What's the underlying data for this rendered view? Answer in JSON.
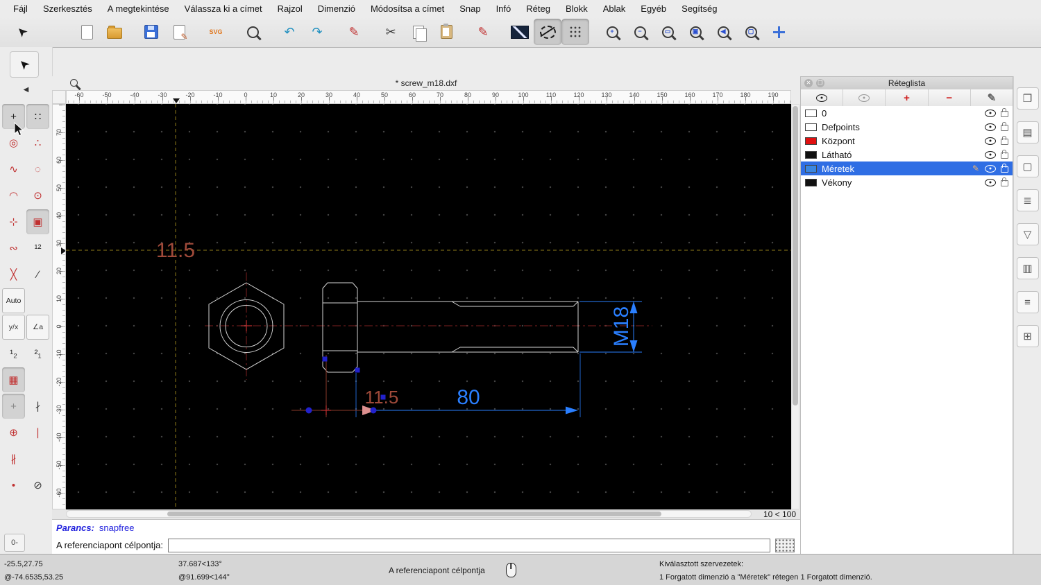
{
  "app": {
    "title_document": "* screw_m18.dxf",
    "zoom_indicator": "10 < 100"
  },
  "colors": {
    "selection_blue": "#2f6ee4",
    "dim_blue": "#2a7fff",
    "dim_red": "#a04a3a",
    "layer_red": "#e01010",
    "crosshair_olive": "#8f7d1a",
    "centerline_red": "#7d2020",
    "canvas_bg": "#000000",
    "handle_blue": "#2222cc"
  },
  "menu": {
    "items": [
      "Fájl",
      "Szerkesztés",
      "A megtekintése",
      "Válassza ki a címet",
      "Rajzol",
      "Dimenzió",
      "Módosítsa a címet",
      "Snap",
      "Infó",
      "Réteg",
      "Blokk",
      "Ablak",
      "Egyéb",
      "Segítség"
    ]
  },
  "toolbar": {
    "buttons": [
      {
        "name": "select",
        "glyph": "➤",
        "color": "#1a1a1a",
        "rot": true
      },
      {
        "name": "new-file",
        "kind": "k-file",
        "gap": true
      },
      {
        "name": "open-file",
        "kind": "k-folder"
      },
      {
        "name": "save",
        "kind": "k-save",
        "gap": true
      },
      {
        "name": "edit-drawing",
        "kind": "k-filepen"
      },
      {
        "name": "svg-export",
        "kind": "k-svg",
        "text": "SVG",
        "gap": true
      },
      {
        "name": "print-preview",
        "kind": "k-mag",
        "gap": true
      },
      {
        "name": "undo",
        "glyph": "↶",
        "color": "#1f8fbf",
        "gap": true
      },
      {
        "name": "redo",
        "glyph": "↷",
        "color": "#1f8fbf"
      },
      {
        "name": "draw-pen",
        "glyph": "✎",
        "color": "#c03030",
        "gap": true
      },
      {
        "name": "cut",
        "glyph": "✂",
        "color": "#333333",
        "gap": true
      },
      {
        "name": "copy",
        "kind": "k-copy"
      },
      {
        "name": "paste",
        "kind": "k-clip"
      },
      {
        "name": "edit-pen",
        "glyph": "✎",
        "color": "#c03030",
        "gap": true
      },
      {
        "name": "line-attributes",
        "kind": "k-linebox",
        "gap": true
      },
      {
        "name": "circle-tool",
        "kind": "k-circle",
        "active": true
      },
      {
        "name": "snap-grid-toolbar",
        "kind": "k-grid",
        "active": true
      },
      {
        "name": "zoom-in",
        "kind": "k-mag",
        "sub": "+",
        "gap": true
      },
      {
        "name": "zoom-out",
        "kind": "k-mag",
        "sub": "−"
      },
      {
        "name": "zoom-auto",
        "kind": "k-mag",
        "sub": "▭"
      },
      {
        "name": "zoom-selected",
        "kind": "k-mag",
        "sub": "▣"
      },
      {
        "name": "zoom-previous",
        "kind": "k-mag",
        "sub": "◀"
      },
      {
        "name": "zoom-window",
        "kind": "k-mag",
        "sub": "▢"
      },
      {
        "name": "pan",
        "kind": "k-pan"
      }
    ]
  },
  "palette": {
    "select_glyph": "➤",
    "collapse_glyph": "◀",
    "bottom_glyph": "0-",
    "items": [
      {
        "name": "snap-free",
        "glyph": "+",
        "color": "#222222",
        "active": true
      },
      {
        "name": "snap-grid",
        "glyph": "∷",
        "color": "#222222",
        "active": true
      },
      {
        "name": "snap-endpoint",
        "glyph": "◎",
        "color": "#c03030"
      },
      {
        "name": "snap-on-entity",
        "glyph": "∴",
        "color": "#c03030"
      },
      {
        "name": "snap-center",
        "glyph": "∿",
        "color": "#c03030"
      },
      {
        "name": "snap-distance",
        "glyph": "◌",
        "color": "#c03030"
      },
      {
        "name": "snap-middle",
        "glyph": "◠",
        "color": "#c03030"
      },
      {
        "name": "snap-reference",
        "glyph": "⊙",
        "color": "#c03030"
      },
      {
        "name": "snap-nearest",
        "glyph": "⊹",
        "color": "#c03030"
      },
      {
        "name": "snap-grid-point",
        "glyph": "▣",
        "color": "#c03030",
        "active": true
      },
      {
        "name": "snap-freehand",
        "glyph": "∾",
        "color": "#c03030"
      },
      {
        "name": "snap-order",
        "glyph": "¹²",
        "color": "#333333"
      },
      {
        "name": "snap-intersection",
        "glyph": "╳",
        "color": "#c03030"
      },
      {
        "name": "restrict-orthogonal",
        "glyph": "∕",
        "color": "#333333"
      },
      {
        "name": "snap-auto",
        "label": "Auto",
        "boxed": true
      },
      {
        "blank": true
      },
      {
        "name": "coords-cartesian",
        "glyph": "y/x",
        "small": true,
        "color": "#333333",
        "boxed": true
      },
      {
        "name": "coords-polar",
        "glyph": "∠a",
        "small": true,
        "color": "#333333",
        "boxed": true
      },
      {
        "name": "order-1-2",
        "glyph": "¹₂",
        "color": "#333333"
      },
      {
        "name": "order-2-1",
        "glyph": "²₁",
        "color": "#333333"
      },
      {
        "name": "highlight-entity",
        "glyph": "▦",
        "color": "#c03030",
        "active": true
      },
      {
        "blank": true
      },
      {
        "name": "set-relative-zero",
        "glyph": "+",
        "color": "#888888",
        "active": true
      },
      {
        "name": "restrict-vertical",
        "glyph": "∤",
        "color": "#333333"
      },
      {
        "name": "snap-circle-plus",
        "glyph": "⊕",
        "color": "#c03030"
      },
      {
        "name": "restrict-horizontal",
        "glyph": "∣",
        "color": "#c03030"
      },
      {
        "name": "hatch-tool",
        "glyph": "∦",
        "color": "#c03030"
      },
      {
        "blank": true
      },
      {
        "name": "snap-point",
        "glyph": "•",
        "color": "#c03030"
      },
      {
        "name": "lock-relative-zero",
        "glyph": "⊘",
        "color": "#333333"
      }
    ]
  },
  "rulers": {
    "horizontal": [
      "-60",
      "-50",
      "-40",
      "-30",
      "-20",
      "-10",
      "0",
      "10",
      "20",
      "30",
      "40",
      "50",
      "60",
      "70",
      "80",
      "90",
      "100",
      "110",
      "120",
      "130",
      "140",
      "150",
      "160",
      "170",
      "180",
      "190"
    ],
    "vertical": [
      "70",
      "60",
      "50",
      "40",
      "30",
      "20",
      "10",
      "0",
      "-10",
      "-20",
      "-30",
      "-40",
      "-50",
      "-60"
    ]
  },
  "layer_panel": {
    "title": "Réteglista",
    "close_glyph": "✕",
    "detach_glyph": "❐",
    "tools": [
      {
        "name": "show-all-layers",
        "icon": "eye"
      },
      {
        "name": "hide-all-layers",
        "icon": "eye-dim"
      },
      {
        "name": "add-layer",
        "glyph": "+",
        "color": "#d02020"
      },
      {
        "name": "remove-layer",
        "glyph": "−",
        "color": "#d02020"
      },
      {
        "name": "modify-layer",
        "glyph": "✎",
        "color": "#666666"
      }
    ],
    "layers": [
      {
        "name": "0",
        "color": "#ffffff"
      },
      {
        "name": "Defpoints",
        "color": "#ffffff"
      },
      {
        "name": "Központ",
        "color": "#e01010"
      },
      {
        "name": "Látható",
        "color": "#111111"
      },
      {
        "name": "Méretek",
        "color": "#3a86e0",
        "selected": true
      },
      {
        "name": "Vékony",
        "color": "#111111"
      }
    ]
  },
  "right_strip": {
    "buttons": [
      {
        "name": "toggle-library-browser",
        "glyph": "❒"
      },
      {
        "name": "toggle-block-list",
        "glyph": "▤"
      },
      {
        "name": "toggle-quick-info",
        "glyph": "▢"
      },
      {
        "name": "toggle-entity-list",
        "glyph": "≣"
      },
      {
        "name": "toggle-selection-filter",
        "glyph": "▽"
      },
      {
        "name": "toggle-matrix-widget",
        "glyph": "▥"
      },
      {
        "name": "toggle-command-widget",
        "glyph": "≡"
      },
      {
        "name": "toggle-clipboard",
        "glyph": "⊞"
      }
    ]
  },
  "drawing": {
    "dim_top": "11.5",
    "dim_bottom": "11.5",
    "dim_length": "80",
    "dim_thread": "M18"
  },
  "command": {
    "prompt": "Parancs:",
    "echo": "snapfree",
    "input_label": "A referenciapont célpontja:",
    "input_value": ""
  },
  "status": {
    "coords_abs": "-25.5,27.75",
    "coords_rel": "@-74.6535,53.25",
    "angle_abs": "37.687<133°",
    "angle_rel": "@91.699<144°",
    "hint": "A referenciapont célpontja",
    "selection_title": "Kiválasztott szervezetek:",
    "selection_detail": "1 Forgatott dimenzió a \"Méretek\" rétegen 1 Forgatott dimenzió."
  }
}
